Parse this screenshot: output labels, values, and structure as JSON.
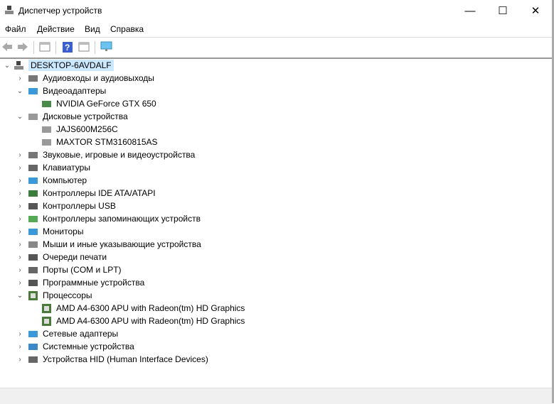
{
  "window": {
    "title": "Диспетчер устройств",
    "minimize": "—",
    "maximize": "☐",
    "close": "✕"
  },
  "menu": [
    "Файл",
    "Действие",
    "Вид",
    "Справка"
  ],
  "tree": {
    "root": "DESKTOP-6AVDALF",
    "items": [
      {
        "label": "Аудиовходы и аудиовыходы",
        "level": 1,
        "expanded": false,
        "icon": "speaker-icon"
      },
      {
        "label": "Видеоадаптеры",
        "level": 1,
        "expanded": true,
        "icon": "monitor-icon"
      },
      {
        "label": "NVIDIA GeForce GTX 650",
        "level": 2,
        "icon": "display-adapter-icon"
      },
      {
        "label": "Дисковые устройства",
        "level": 1,
        "expanded": true,
        "icon": "disk-icon"
      },
      {
        "label": "JAJS600M256C",
        "level": 2,
        "icon": "disk-icon"
      },
      {
        "label": "MAXTOR STM3160815AS",
        "level": 2,
        "icon": "disk-icon"
      },
      {
        "label": "Звуковые, игровые и видеоустройства",
        "level": 1,
        "expanded": false,
        "icon": "speaker-icon"
      },
      {
        "label": "Клавиатуры",
        "level": 1,
        "expanded": false,
        "icon": "keyboard-icon"
      },
      {
        "label": "Компьютер",
        "level": 1,
        "expanded": false,
        "icon": "monitor-icon"
      },
      {
        "label": "Контроллеры IDE ATA/ATAPI",
        "level": 1,
        "expanded": false,
        "icon": "controller-icon"
      },
      {
        "label": "Контроллеры USB",
        "level": 1,
        "expanded": false,
        "icon": "usb-icon"
      },
      {
        "label": "Контроллеры запоминающих устройств",
        "level": 1,
        "expanded": false,
        "icon": "storage-controller-icon"
      },
      {
        "label": "Мониторы",
        "level": 1,
        "expanded": false,
        "icon": "monitor-icon"
      },
      {
        "label": "Мыши и иные указывающие устройства",
        "level": 1,
        "expanded": false,
        "icon": "mouse-icon"
      },
      {
        "label": "Очереди печати",
        "level": 1,
        "expanded": false,
        "icon": "printer-icon"
      },
      {
        "label": "Порты (COM и LPT)",
        "level": 1,
        "expanded": false,
        "icon": "port-icon"
      },
      {
        "label": "Программные устройства",
        "level": 1,
        "expanded": false,
        "icon": "software-device-icon"
      },
      {
        "label": "Процессоры",
        "level": 1,
        "expanded": true,
        "icon": "cpu-icon"
      },
      {
        "label": "AMD A4-6300 APU with Radeon(tm) HD Graphics",
        "level": 2,
        "icon": "cpu-icon"
      },
      {
        "label": "AMD A4-6300 APU with Radeon(tm) HD Graphics",
        "level": 2,
        "icon": "cpu-icon"
      },
      {
        "label": "Сетевые адаптеры",
        "level": 1,
        "expanded": false,
        "icon": "network-icon"
      },
      {
        "label": "Системные устройства",
        "level": 1,
        "expanded": false,
        "icon": "system-icon"
      },
      {
        "label": "Устройства HID (Human Interface Devices)",
        "level": 1,
        "expanded": false,
        "icon": "hid-icon"
      }
    ]
  }
}
